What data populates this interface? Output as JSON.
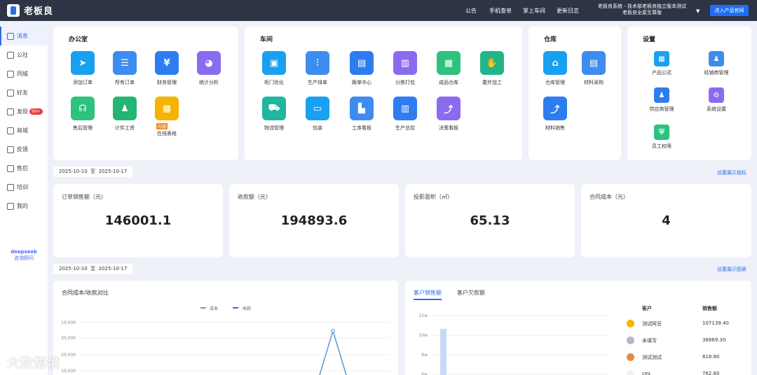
{
  "app": {
    "title": "老板良"
  },
  "topnav": [
    "公告",
    "手机查单",
    "掌上车间",
    "更新日志"
  ],
  "system_info": {
    "line1": "老板良系统 - 技术部老板良独立版本测试",
    "line2": "老板良全屋至尊版"
  },
  "enter_button": "进入产品官网",
  "sidebar": [
    {
      "label": "消息",
      "active": true
    },
    {
      "label": "公社"
    },
    {
      "label": "同城"
    },
    {
      "label": "好友"
    },
    {
      "label": "发现",
      "badge": "99+"
    },
    {
      "label": "商城"
    },
    {
      "label": "反馈"
    },
    {
      "label": "售后"
    },
    {
      "label": "培训"
    },
    {
      "label": "我的"
    }
  ],
  "deepseek": {
    "logo": "deepseek",
    "sub": "咨询顾问"
  },
  "office": {
    "title": "办公室",
    "tiles": [
      {
        "label": "添加订单",
        "color": "#1aa0f0",
        "icon": "paper-plane-icon",
        "glyph": "➤"
      },
      {
        "label": "所有订单",
        "color": "#3d8cf0",
        "icon": "document-icon",
        "glyph": "☰"
      },
      {
        "label": "财务管理",
        "color": "#2d7df0",
        "icon": "yen-icon",
        "glyph": "¥"
      },
      {
        "label": "统计分析",
        "color": "#8a6bf0",
        "icon": "pie-chart-icon",
        "glyph": "◕"
      },
      {
        "label": "售后管理",
        "color": "#2ec27e",
        "icon": "headset-icon",
        "glyph": "☊"
      },
      {
        "label": "计件工资",
        "color": "#22b573",
        "icon": "user-money-icon",
        "glyph": "♟"
      },
      {
        "label": "在线表格",
        "color": "#f5b400",
        "icon": "table-icon",
        "glyph": "▦",
        "tag": "内测"
      }
    ]
  },
  "workshop": {
    "title": "车间",
    "tiles": [
      {
        "label": "柜门优化",
        "color": "#1aa0f0",
        "icon": "layout-icon",
        "glyph": "▣"
      },
      {
        "label": "生产排单",
        "color": "#3d8cf0",
        "icon": "sliders-icon",
        "glyph": "⫶"
      },
      {
        "label": "跟单中心",
        "color": "#2d7df0",
        "icon": "calendar-icon",
        "glyph": "▤"
      },
      {
        "label": "分拣打包",
        "color": "#8a6bf0",
        "icon": "print-icon",
        "glyph": "▥"
      },
      {
        "label": "成品仓库",
        "color": "#2ec27e",
        "icon": "boxes-icon",
        "glyph": "▦"
      },
      {
        "label": "委外加工",
        "color": "#22b58a",
        "icon": "hand-box-icon",
        "glyph": "✋"
      },
      {
        "label": "物流管理",
        "color": "#22b5a0",
        "icon": "truck-icon",
        "glyph": "⛟"
      },
      {
        "label": "包装",
        "color": "#1aa0f0",
        "icon": "package-icon",
        "glyph": "▭"
      },
      {
        "label": "工序看板",
        "color": "#3d8cf0",
        "icon": "report-icon",
        "glyph": "▙"
      },
      {
        "label": "生产总控",
        "color": "#2d7df0",
        "icon": "bar-chart-icon",
        "glyph": "▥"
      },
      {
        "label": "决策看板",
        "color": "#8a6bf0",
        "icon": "trend-icon",
        "glyph": "⤴"
      }
    ]
  },
  "warehouse": {
    "title": "仓库",
    "tiles": [
      {
        "label": "仓库管理",
        "color": "#1aa0f0",
        "icon": "warehouse-icon",
        "glyph": "⌂"
      },
      {
        "label": "材料采购",
        "color": "#3d8cf0",
        "icon": "cart-icon",
        "glyph": "▤"
      },
      {
        "label": "材料销售",
        "color": "#2d7df0",
        "icon": "sales-chart-icon",
        "glyph": "⤴"
      }
    ]
  },
  "settings": {
    "title": "设置",
    "tiles": [
      {
        "label": "产品公式",
        "color": "#1aa0f0",
        "icon": "grid-icon",
        "glyph": "▦"
      },
      {
        "label": "经销商管理",
        "color": "#3d8cf0",
        "icon": "user-card-icon",
        "glyph": "♟"
      },
      {
        "label": "供应商管理",
        "color": "#2d7df0",
        "icon": "supplier-icon",
        "glyph": "♟"
      },
      {
        "label": "系统设置",
        "color": "#8a6bf0",
        "icon": "gear-icon",
        "glyph": "⚙"
      },
      {
        "label": "员工权限",
        "color": "#2ec27e",
        "icon": "shield-icon",
        "glyph": "⛨"
      }
    ]
  },
  "date_range1": {
    "start": "2025-10-10",
    "sep": "至",
    "end": "2025-10-17"
  },
  "link1": "设置展示指标",
  "kpis": [
    {
      "label": "订单销售额（元）",
      "value": "146001.1"
    },
    {
      "label": "收款额（元）",
      "value": "194893.6"
    },
    {
      "label": "投影面积（㎡）",
      "value": "65.13"
    },
    {
      "label": "合同成本（元）",
      "value": "4"
    }
  ],
  "date_range2": {
    "start": "2025-10-10",
    "sep": "至",
    "end": "2025-10-17"
  },
  "link2": "设置展示图表",
  "chart_data": [
    {
      "type": "line",
      "title": "合同成本/收款对比",
      "legend": [
        "成本",
        "收款"
      ],
      "legend_position": "top-center",
      "y_ticks": [
        "10,000",
        "30,000",
        "20,000",
        "10,000"
      ],
      "series": [
        {
          "name": "成本",
          "color": "#5b9bd5",
          "visible_peak": "high spike near the right (partial view)"
        },
        {
          "name": "收款",
          "color": "#2f6fe0"
        }
      ]
    },
    {
      "type": "bar",
      "y_ticks": [
        "12w",
        "10w",
        "8w",
        "6w"
      ],
      "series": [
        {
          "color": "#c9d9f5"
        }
      ]
    }
  ],
  "sales_panel": {
    "tabs": [
      "客户销售额",
      "客户欠款额"
    ],
    "headers": [
      "客户",
      "销售额"
    ],
    "rows": [
      {
        "rank": "1",
        "name": "测试阿豆",
        "value": "107139.40",
        "medal": "#f5b400"
      },
      {
        "rank": "2",
        "name": "未填写",
        "value": "36869.30",
        "medal": "#b0b8c8"
      },
      {
        "rank": "3",
        "name": "测试测试",
        "value": "818.80",
        "medal": "#e08a4a"
      },
      {
        "rank": "4",
        "name": "ces",
        "value": "762.60",
        "medal": "#f0f0f0"
      }
    ]
  },
  "watermark": "大数悟境"
}
